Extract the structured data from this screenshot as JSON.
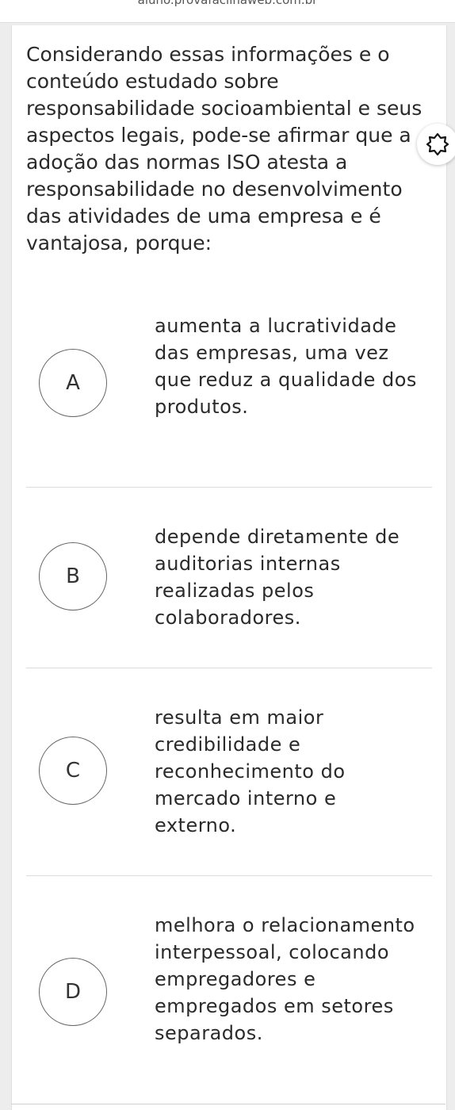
{
  "browser": {
    "url": "aluno.provafacilnaweb.com.br"
  },
  "question": {
    "text": "Considerando essas informações e o conteúdo estudado sobre responsabilidade socioambiental e seus aspectos legais, pode-se afirmar que a adoção das normas ISO atesta a responsabilidade no desenvolvimento das atividades de uma empresa e é vantajosa, porque:"
  },
  "options": [
    {
      "letter": "A",
      "text": "aumenta a lucratividade das empresas, uma vez que reduz a qualidade dos produtos."
    },
    {
      "letter": "B",
      "text": "depende diretamente de auditorias internas realizadas pelos colaboradores."
    },
    {
      "letter": "C",
      "text": "resulta em maior credibilidade e reconhecimento do mercado interno e externo."
    },
    {
      "letter": "D",
      "text": "melhora o relacionamento interpessoal, colocando empregadores e empregados em setores separados."
    }
  ],
  "floating_button": {
    "icon": "brightness-icon"
  }
}
